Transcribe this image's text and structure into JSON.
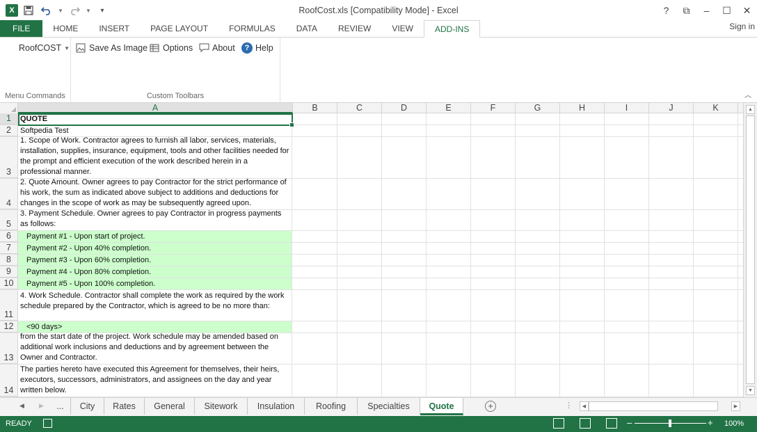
{
  "window": {
    "title": "RoofCost.xls  [Compatibility Mode] - Excel",
    "app_logo": "X",
    "controls": {
      "help": "?",
      "restore_ribbon": "⧉",
      "minimize": "–",
      "maximize": "☐",
      "close": "✕"
    }
  },
  "qat": {
    "save_icon": "save-icon",
    "undo_icon": "undo-icon",
    "redo_icon": "redo-icon",
    "customize_icon": "customize-icon"
  },
  "ribbon": {
    "tabs": [
      "FILE",
      "HOME",
      "INSERT",
      "PAGE LAYOUT",
      "FORMULAS",
      "DATA",
      "REVIEW",
      "VIEW",
      "ADD-INS"
    ],
    "active_tab": "ADD-INS",
    "sign_in": "Sign in",
    "groups": {
      "menu_commands": {
        "label": "Menu Commands",
        "roofcost_button": "RoofCOST"
      },
      "custom_toolbars": {
        "label": "Custom Toolbars",
        "save_as_image": "Save As Image",
        "options": "Options",
        "about": "About",
        "help": "Help"
      }
    }
  },
  "grid": {
    "columns": [
      "A",
      "B",
      "C",
      "D",
      "E",
      "F",
      "G",
      "H",
      "I",
      "J",
      "K"
    ],
    "selected_column": "A",
    "selected_row": "1",
    "rows": [
      {
        "num": "1",
        "text": "QUOTE"
      },
      {
        "num": "2",
        "text": "Softpedia Test"
      },
      {
        "num": "3",
        "text": "1. Scope of Work. Contractor agrees to furnish all labor, services, materials, installation, supplies, insurance, equipment, tools and other facilities needed for the prompt and efficient execution of the work described herein in a professional manner."
      },
      {
        "num": "4",
        "text": "2. Quote Amount. Owner agrees to pay Contractor for the strict performance of his work, the sum as indicated above subject to additions and deductions for changes in the scope of work as may be subsequently agreed upon."
      },
      {
        "num": "5",
        "text": "3. Payment Schedule. Owner agrees to pay Contractor in progress payments as follows:"
      },
      {
        "num": "6",
        "text": "Payment #1 - Upon start of project."
      },
      {
        "num": "7",
        "text": "Payment #2 - Upon 40% completion."
      },
      {
        "num": "8",
        "text": "Payment #3 - Upon 60% completion."
      },
      {
        "num": "9",
        "text": "Payment #4 - Upon 80% completion."
      },
      {
        "num": "10",
        "text": "Payment #5 - Upon 100% completion."
      },
      {
        "num": "11",
        "text": "4. Work Schedule. Contractor shall complete the work as required by the work schedule prepared by the Contractor, which is agreed to be no more than:"
      },
      {
        "num": "12",
        "text": "<90 days>"
      },
      {
        "num": "13",
        "text": "from the start date of the project. Work schedule may be amended based on additional work inclusions and deductions and by agreement between the Owner and Contractor."
      },
      {
        "num": "14",
        "text": "The parties hereto have executed this Agreement for themselves, their heirs, executors, successors, administrators, and assignees on the day and year written below."
      }
    ]
  },
  "sheets": {
    "ellipsis": "...",
    "tabs": [
      "City",
      "Rates",
      "General",
      "Sitework",
      "Insulation",
      "Roofing",
      "Specialties",
      "Quote"
    ],
    "active": "Quote",
    "add_icon": "plus-circle-icon"
  },
  "status": {
    "ready": "READY",
    "zoom": "100%",
    "zoom_minus": "–",
    "zoom_plus": "+"
  },
  "colors": {
    "accent": "#217346",
    "highlight": "#ccffcc"
  }
}
